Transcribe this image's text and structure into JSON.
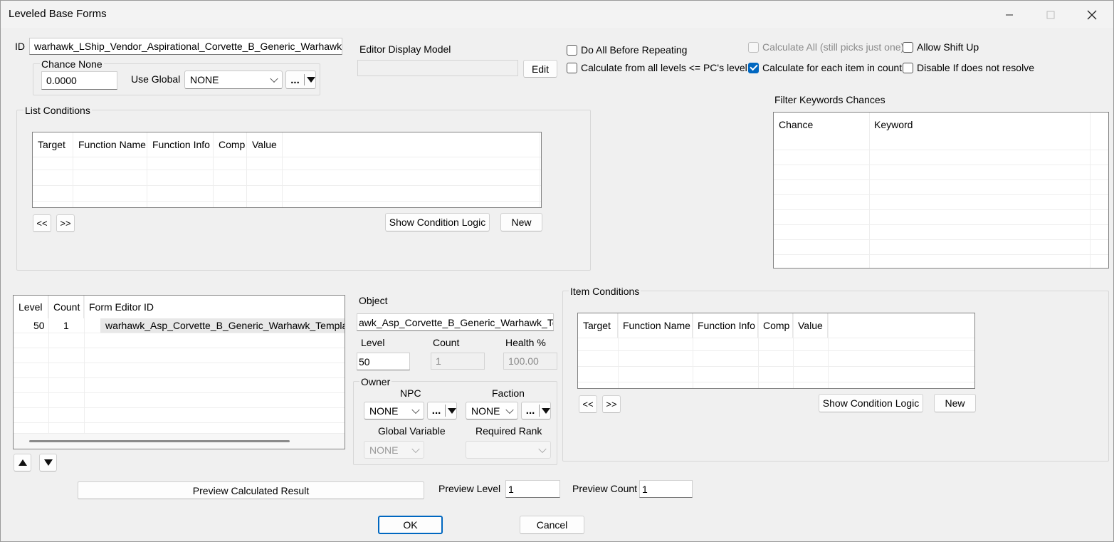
{
  "window": {
    "title": "Leveled Base Forms"
  },
  "id_field": {
    "label": "ID",
    "value": "warhawk_LShip_Vendor_Aspirational_Corvette_B_Generic_Warhawk"
  },
  "chance_none": {
    "group": "Chance None",
    "value": "0.0000",
    "use_global_label": "Use Global",
    "use_global_value": "NONE",
    "dots": "..."
  },
  "editor_display_model": {
    "label": "Editor Display Model",
    "value": "",
    "edit_label": "Edit"
  },
  "flags": {
    "do_all_before_repeating": {
      "label": "Do All Before Repeating",
      "checked": false
    },
    "calc_all_levels": {
      "label": "Calculate from all levels <= PC's level",
      "checked": false
    },
    "calc_all": {
      "label": "Calculate All (still picks just one)",
      "checked": false,
      "disabled": true
    },
    "calc_each_item": {
      "label": "Calculate for each item in count",
      "checked": true
    },
    "allow_shift_up": {
      "label": "Allow Shift Up",
      "checked": false
    },
    "disable_if_not_resolve": {
      "label": "Disable If does not resolve",
      "checked": false
    }
  },
  "list_conditions": {
    "group": "List Conditions",
    "columns": [
      "Target",
      "Function Name",
      "Function Info",
      "Comp",
      "Value"
    ],
    "prev": "<<",
    "next": ">>",
    "show_logic": "Show Condition Logic",
    "new": "New"
  },
  "filter_keywords": {
    "label": "Filter Keywords Chances",
    "columns": [
      "Chance",
      "Keyword"
    ]
  },
  "entries": {
    "columns": [
      "Level",
      "Count",
      "Form Editor ID"
    ],
    "rows": [
      {
        "level": "50",
        "count": "1",
        "form": "warhawk_Asp_Corvette_B_Generic_Warhawk_Template"
      }
    ]
  },
  "object": {
    "label": "Object",
    "value": "awk_Asp_Corvette_B_Generic_Warhawk_Ten",
    "level_label": "Level",
    "level_value": "50",
    "count_label": "Count",
    "count_value": "1",
    "health_label": "Health %",
    "health_value": "100.00"
  },
  "owner": {
    "group": "Owner",
    "npc_label": "NPC",
    "npc_value": "NONE",
    "faction_label": "Faction",
    "faction_value": "NONE",
    "global_label": "Global Variable",
    "global_value": "NONE",
    "rank_label": "Required Rank",
    "rank_value": "",
    "dots": "..."
  },
  "item_conditions": {
    "group": "Item Conditions",
    "columns": [
      "Target",
      "Function Name",
      "Function Info",
      "Comp",
      "Value"
    ],
    "prev": "<<",
    "next": ">>",
    "show_logic": "Show Condition Logic",
    "new": "New"
  },
  "preview": {
    "button": "Preview Calculated Result",
    "level_label": "Preview Level",
    "level_value": "1",
    "count_label": "Preview Count",
    "count_value": "1"
  },
  "footer": {
    "ok": "OK",
    "cancel": "Cancel"
  },
  "colors": {
    "accent": "#0067c0",
    "background": "#f0f0f0"
  }
}
